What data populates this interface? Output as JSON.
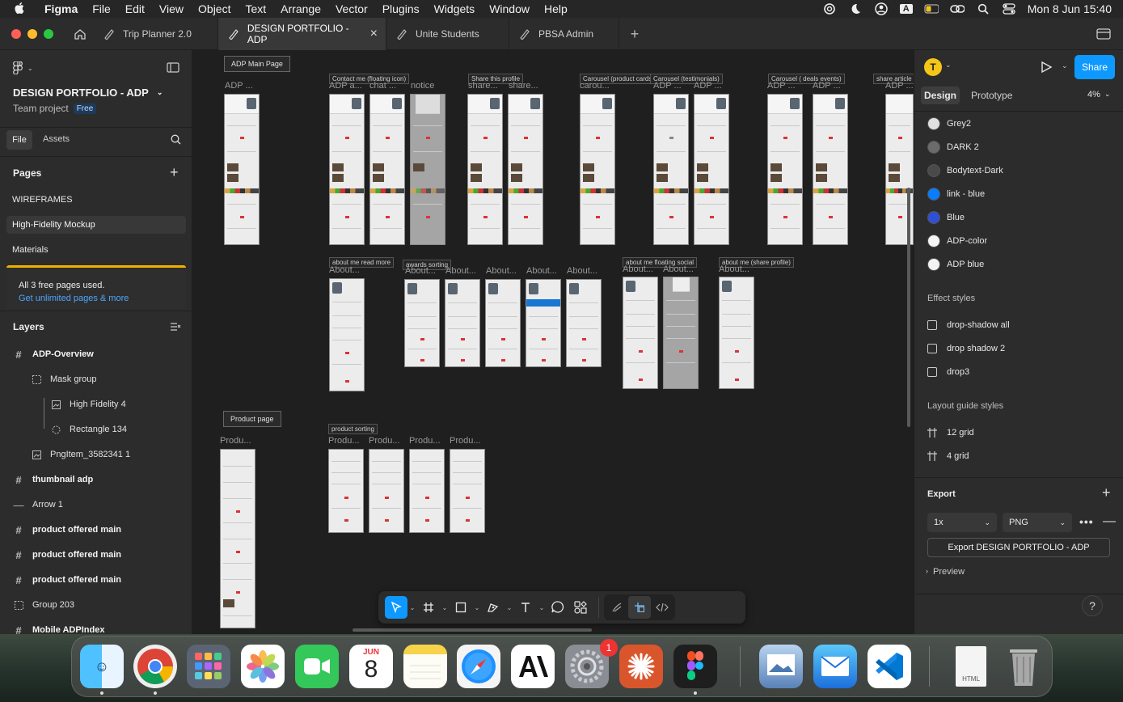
{
  "menubar": {
    "app": "Figma",
    "items": [
      "File",
      "Edit",
      "View",
      "Object",
      "Text",
      "Arrange",
      "Vector",
      "Plugins",
      "Widgets",
      "Window",
      "Help"
    ],
    "input_badge": "A",
    "datetime": "Mon 8 Jun  15:40"
  },
  "tabs": [
    {
      "label": "Trip Planner 2.0"
    },
    {
      "label": "DESIGN PORTFOLIO - ADP",
      "active": true
    },
    {
      "label": "Unite Students"
    },
    {
      "label": "PBSA Admin"
    }
  ],
  "left": {
    "file_name": "DESIGN PORTFOLIO - ADP",
    "team": "Team project",
    "plan_badge": "Free",
    "tab_file": "File",
    "tab_assets": "Assets",
    "pages_title": "Pages",
    "pages": [
      "WIREFRAMES",
      "High-Fidelity Mockup",
      "Materials"
    ],
    "notice": "All 3 free pages used.",
    "notice_link": "Get unlimited pages & more",
    "layers_title": "Layers",
    "layers": [
      {
        "name": "ADP-Overview",
        "icon": "frame-icon",
        "bold": true
      },
      {
        "name": "Mask group",
        "icon": "mask-group-icon"
      },
      {
        "name": "High Fidelity 4",
        "icon": "image-icon"
      },
      {
        "name": "Rectangle 134",
        "icon": "rectangle-mask-icon"
      },
      {
        "name": "PngItem_3582341 1",
        "icon": "image-icon"
      },
      {
        "name": "thumbnail adp",
        "icon": "frame-icon",
        "bold": true
      },
      {
        "name": "Arrow 1",
        "icon": "line-icon"
      },
      {
        "name": "product offered main",
        "icon": "frame-icon",
        "bold": true
      },
      {
        "name": "product offered main",
        "icon": "frame-icon",
        "bold": true
      },
      {
        "name": "product offered main",
        "icon": "frame-icon",
        "bold": true
      },
      {
        "name": "Group 203",
        "icon": "group-icon"
      },
      {
        "name": "Mobile ADPIndex",
        "icon": "frame-icon",
        "bold": true
      }
    ]
  },
  "canvas": {
    "labels": {
      "main_page": "ADP Main Page",
      "product_page": "Product page",
      "contact": "Contact me (floating icon)",
      "share_profile": "Share this profile",
      "carousel_product": "Carousel (product cards)",
      "carousel_testimonials": "Carousel (testimonials)",
      "carousel_events": "Carousel ( deals events)",
      "share_article": "share article on ADP",
      "about_read_more": "about me read more",
      "awards_sorting": "awards sorting",
      "about_floating_social": "about me floating social",
      "about_share_profile": "about me (share profile)",
      "product_sorting": "product sorting"
    },
    "frame_names": {
      "adp": "ADP ...",
      "adp_a": "ADP a...",
      "chat": "chat ...",
      "notice": "notice",
      "share": "share...",
      "carou": "carou...",
      "about": "About...",
      "produ": "Produ..."
    }
  },
  "toolbar": {
    "tools": [
      "move-tool",
      "frame-tool",
      "shape-tool",
      "pen-tool",
      "text-tool",
      "comment-tool",
      "actions-tool"
    ],
    "modes": [
      "draw-mode",
      "design-mode",
      "dev-mode"
    ]
  },
  "right": {
    "avatar_letter": "T",
    "share_label": "Share",
    "tab_design": "Design",
    "tab_prototype": "Prototype",
    "zoom": "4%",
    "color_styles": [
      {
        "name": "Grey2",
        "color": "#e0e0e0"
      },
      {
        "name": "DARK 2",
        "color": "#6b6b6b"
      },
      {
        "name": "Bodytext-Dark",
        "color": "#4a4a4a"
      },
      {
        "name": "link - blue",
        "color": "#0a7cff"
      },
      {
        "name": "Blue",
        "color": "#2e4fd6"
      },
      {
        "name": "ADP-color",
        "color": "#f5f5f5"
      },
      {
        "name": "ADP blue",
        "color": "#f2f2f2"
      }
    ],
    "effect_title": "Effect styles",
    "effects": [
      "drop-shadow all",
      "drop shadow 2",
      "drop3"
    ],
    "layout_title": "Layout guide styles",
    "layouts": [
      "12 grid",
      "4 grid"
    ],
    "export_title": "Export",
    "export_scale": "1x",
    "export_format": "PNG",
    "export_button": "Export DESIGN PORTFOLIO - ADP",
    "preview": "Preview",
    "help": "?"
  },
  "dock": {
    "calendar_month": "JUN",
    "calendar_day": "8",
    "settings_badge": "1",
    "html_doc_label": "HTML"
  }
}
